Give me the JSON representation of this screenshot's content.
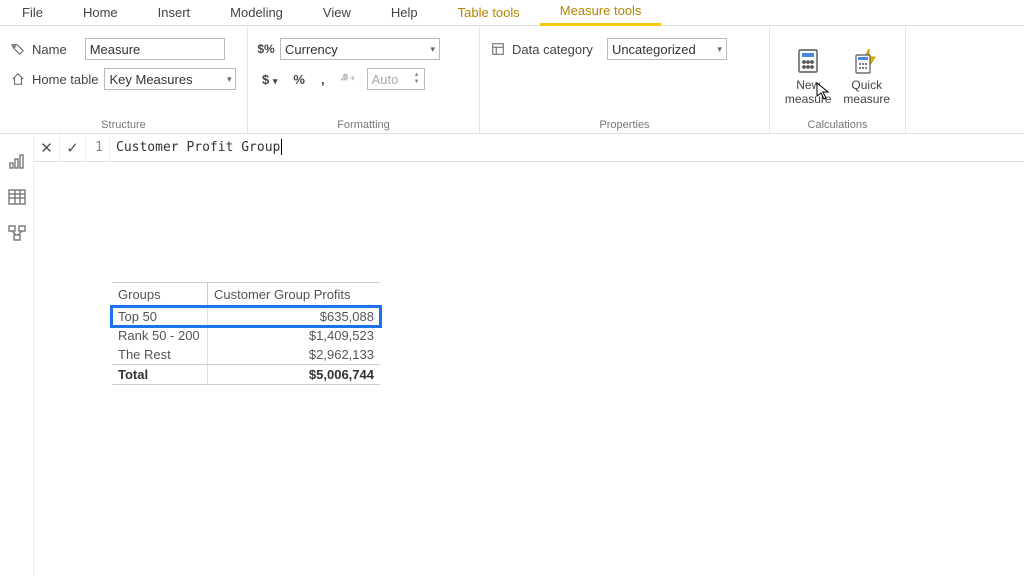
{
  "menu": {
    "file": "File",
    "home": "Home",
    "insert": "Insert",
    "modeling": "Modeling",
    "view": "View",
    "help": "Help",
    "tabletools": "Table tools",
    "measuretools": "Measure tools"
  },
  "ribbon": {
    "structure": {
      "label": "Structure",
      "name_label": "Name",
      "name_value": "Measure",
      "hometable_label": "Home table",
      "hometable_value": "Key Measures"
    },
    "formatting": {
      "label": "Formatting",
      "format_value": "Currency",
      "dollar": "$",
      "percent": "%",
      "comma": ",",
      "decimals": "Auto"
    },
    "properties": {
      "label": "Properties",
      "datacat_label": "Data category",
      "datacat_value": "Uncategorized"
    },
    "calculations": {
      "label": "Calculations",
      "new_measure": "New measure",
      "quick_measure": "Quick measure"
    }
  },
  "formula": {
    "line": "1",
    "text": "Customer Profit Group"
  },
  "table": {
    "col1": "Groups",
    "col2": "Customer Group Profits",
    "rows": [
      {
        "g": "Top 50",
        "v": "$635,088"
      },
      {
        "g": "Rank 50 - 200",
        "v": "$1,409,523"
      },
      {
        "g": "The Rest",
        "v": "$2,962,133"
      }
    ],
    "total_label": "Total",
    "total_value": "$5,006,744"
  }
}
